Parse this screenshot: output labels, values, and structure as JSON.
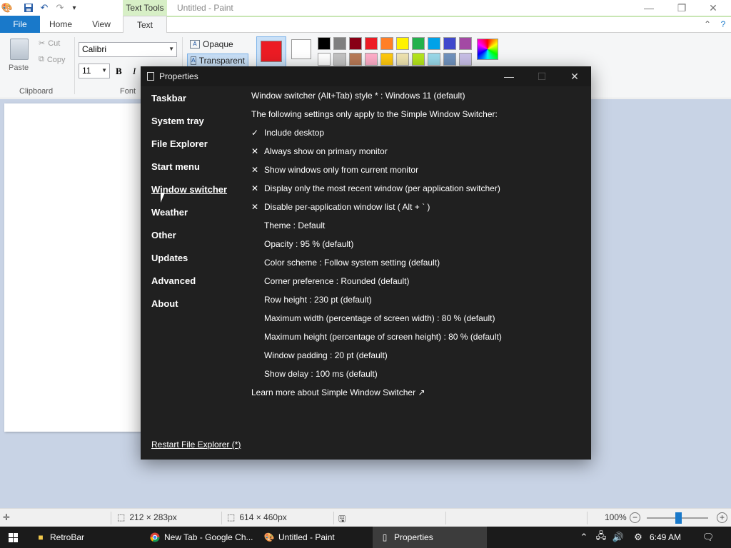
{
  "paint": {
    "title": "Untitled - Paint",
    "context_tab": "Text Tools",
    "tabs": {
      "file": "File",
      "home": "Home",
      "view": "View",
      "text": "Text"
    },
    "clipboard": {
      "paste": "Paste",
      "cut": "Cut",
      "copy": "Copy",
      "group": "Clipboard"
    },
    "font": {
      "name": "Calibri",
      "size": "11",
      "bold": "B",
      "italic": "I",
      "group": "Font"
    },
    "background": {
      "opaque": "Opaque",
      "transparent": "Transparent"
    },
    "colors": {
      "color1": "#ec1c24",
      "color2": "#ffffff",
      "palette_row1": [
        "#000000",
        "#7f7f7f",
        "#880015",
        "#ed1c24",
        "#ff7f27",
        "#fff200",
        "#22b14c",
        "#00a2e8",
        "#3f48cc",
        "#a349a4"
      ],
      "palette_row2": [
        "#ffffff",
        "#c3c3c3",
        "#b97a57",
        "#ffaec9",
        "#ffc90e",
        "#efe4b0",
        "#b5e61d",
        "#99d9ea",
        "#7092be",
        "#c8bfe7"
      ]
    },
    "status": {
      "selection_size": "212 × 283px",
      "canvas_size": "614 × 460px",
      "zoom": "100%"
    }
  },
  "properties": {
    "title": "Properties",
    "nav": [
      "Taskbar",
      "System tray",
      "File Explorer",
      "Start menu",
      "Window switcher",
      "Weather",
      "Other",
      "Updates",
      "Advanced",
      "About"
    ],
    "selected_nav": "Window switcher",
    "rows": [
      {
        "mark": "",
        "text": "Window switcher (Alt+Tab) style * : Windows 11 (default)",
        "indent": false
      },
      {
        "mark": "",
        "text": "The following settings only apply to the Simple Window Switcher:",
        "indent": false
      },
      {
        "mark": "✓",
        "text": "Include desktop",
        "indent": false
      },
      {
        "mark": "✕",
        "text": "Always show on primary monitor",
        "indent": false
      },
      {
        "mark": "✕",
        "text": "Show windows only from current monitor",
        "indent": false
      },
      {
        "mark": "✕",
        "text": "Display only the most recent window (per application switcher)",
        "indent": false
      },
      {
        "mark": "✕",
        "text": "Disable per-application window list ( Alt + ` )",
        "indent": false
      },
      {
        "mark": "",
        "text": "Theme : Default",
        "indent": true
      },
      {
        "mark": "",
        "text": "Opacity : 95 % (default)",
        "indent": true
      },
      {
        "mark": "",
        "text": "Color scheme : Follow system setting (default)",
        "indent": true
      },
      {
        "mark": "",
        "text": "Corner preference : Rounded (default)",
        "indent": true
      },
      {
        "mark": "",
        "text": "Row height : 230 pt (default)",
        "indent": true
      },
      {
        "mark": "",
        "text": "Maximum width (percentage of screen width) : 80 % (default)",
        "indent": true
      },
      {
        "mark": "",
        "text": "Maximum height (percentage of screen height) : 80 % (default)",
        "indent": true
      },
      {
        "mark": "",
        "text": "Window padding : 20 pt (default)",
        "indent": true
      },
      {
        "mark": "",
        "text": "Show delay : 100 ms (default)",
        "indent": true
      },
      {
        "mark": "",
        "text": "Learn more about Simple Window Switcher ↗",
        "indent": false
      }
    ],
    "restart_link": "Restart File Explorer (*)"
  },
  "taskbar": {
    "items": [
      {
        "label": "RetroBar",
        "icon": "folder-icon",
        "active": false
      },
      {
        "label": "New Tab - Google Ch...",
        "icon": "chrome-icon",
        "active": false
      },
      {
        "label": "Untitled - Paint",
        "icon": "paint-icon",
        "active": false
      },
      {
        "label": "Properties",
        "icon": "properties-icon",
        "active": true
      }
    ],
    "time": "6:49 AM"
  }
}
